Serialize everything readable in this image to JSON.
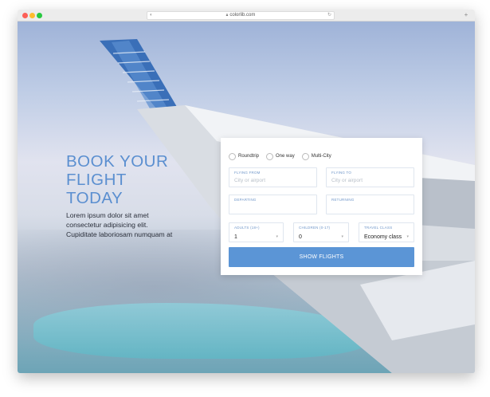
{
  "browser": {
    "address": "colorlib.com",
    "lock_icon": "lock-icon",
    "reload_icon": "reload-icon",
    "new_tab_icon": "plus-icon"
  },
  "hero": {
    "title_line1": "BOOK YOUR",
    "title_line2": "FLIGHT",
    "title_line3": "TODAY",
    "text_line1": "Lorem ipsum dolor sit amet",
    "text_line2": "consectetur adipisicing elit.",
    "text_line3": "Cupiditate laboriosam numquam at"
  },
  "form": {
    "trip_types": [
      "Roundtrip",
      "One way",
      "Multi-City"
    ],
    "flying_from": {
      "label": "FLYING FROM",
      "placeholder": "City or airport"
    },
    "flying_to": {
      "label": "FLYING TO",
      "placeholder": "City or airport"
    },
    "departing": {
      "label": "DEPARTING"
    },
    "returning": {
      "label": "RETURNING"
    },
    "adults": {
      "label": "ADULTS (18+)",
      "value": "1"
    },
    "children": {
      "label": "CHILDREN (0-17)",
      "value": "0"
    },
    "travel_class": {
      "label": "TRAVEL CLASS",
      "value": "Economy class"
    },
    "submit_label": "SHOW FLIGHTS"
  },
  "colors": {
    "accent": "#5b95d6",
    "title": "#5b8fd0"
  }
}
